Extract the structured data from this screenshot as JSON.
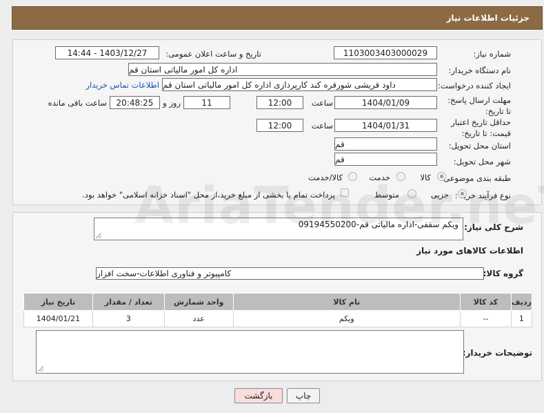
{
  "header": {
    "title": "جزئیات اطلاعات نیاز"
  },
  "form": {
    "need_number_label": "شماره نیاز:",
    "need_number": "1103003403000029",
    "announce_label": "تاریخ و ساعت اعلان عمومی:",
    "announce_value": "1403/12/27 - 14:44",
    "buyer_org_label": "نام دستگاه خریدار:",
    "buyer_org": "اداره کل امور مالیاتی استان قم",
    "creator_label": "ایجاد کننده درخواست:",
    "creator": "داود قریشی شورقره کند کارپردازی اداره کل امور مالیاتی استان قم",
    "contact_link": "اطلاعات تماس خریدار",
    "deadline_label": "مهلت ارسال پاسخ: تا تاریخ:",
    "deadline_date": "1404/01/09",
    "time_label": "ساعت",
    "deadline_time": "12:00",
    "days_value": "11",
    "days_label": "روز و",
    "remaining_value": "20:48:25",
    "remaining_label": "ساعت باقی مانده",
    "validity_label": "حداقل تاریخ اعتبار قیمت: تا تاریخ:",
    "validity_date": "1404/01/31",
    "validity_time": "12:00",
    "province_label": "استان محل تحویل:",
    "province": "قم",
    "city_label": "شهر محل تحویل:",
    "city": "قم",
    "category_label": "طبقه بندی موضوعی:",
    "category_options": [
      "کالا",
      "خدمت",
      "کالا/خدمت"
    ],
    "process_label": "نوع فرآیند خرید :",
    "process_options": [
      "جزیی",
      "متوسط"
    ],
    "payment_note": "پرداخت تمام یا بخشی از مبلغ خرید،از محل \"اسناد خزانه اسلامی\" خواهد بود."
  },
  "details": {
    "description_label": "شرح کلی نیاز:",
    "description": "ویکم سقفی-اداره مالیاتی قم-09194550200",
    "goods_info_title": "اطلاعات کالاهای مورد نیاز",
    "goods_group_label": "گروه کالا:",
    "goods_group": "کامپیوتر و فناوری اطلاعات-سخت افزار",
    "table": {
      "headers": [
        "ردیف",
        "کد کالا",
        "نام کالا",
        "واحد شمارش",
        "تعداد / مقدار",
        "تاریخ نیاز"
      ],
      "rows": [
        [
          "1",
          "--",
          "ویکم",
          "عدد",
          "3",
          "1404/01/21"
        ]
      ]
    },
    "buyer_notes_label": "توضیحات خریدار:",
    "buyer_notes": ""
  },
  "buttons": {
    "print": "چاپ",
    "back": "بازگشت"
  },
  "watermark": "AriaTender.neT",
  "colors": {
    "header_bg": "#8c6b44",
    "link": "#1c4fb3",
    "back_button_bg": "#f9dcdc"
  }
}
